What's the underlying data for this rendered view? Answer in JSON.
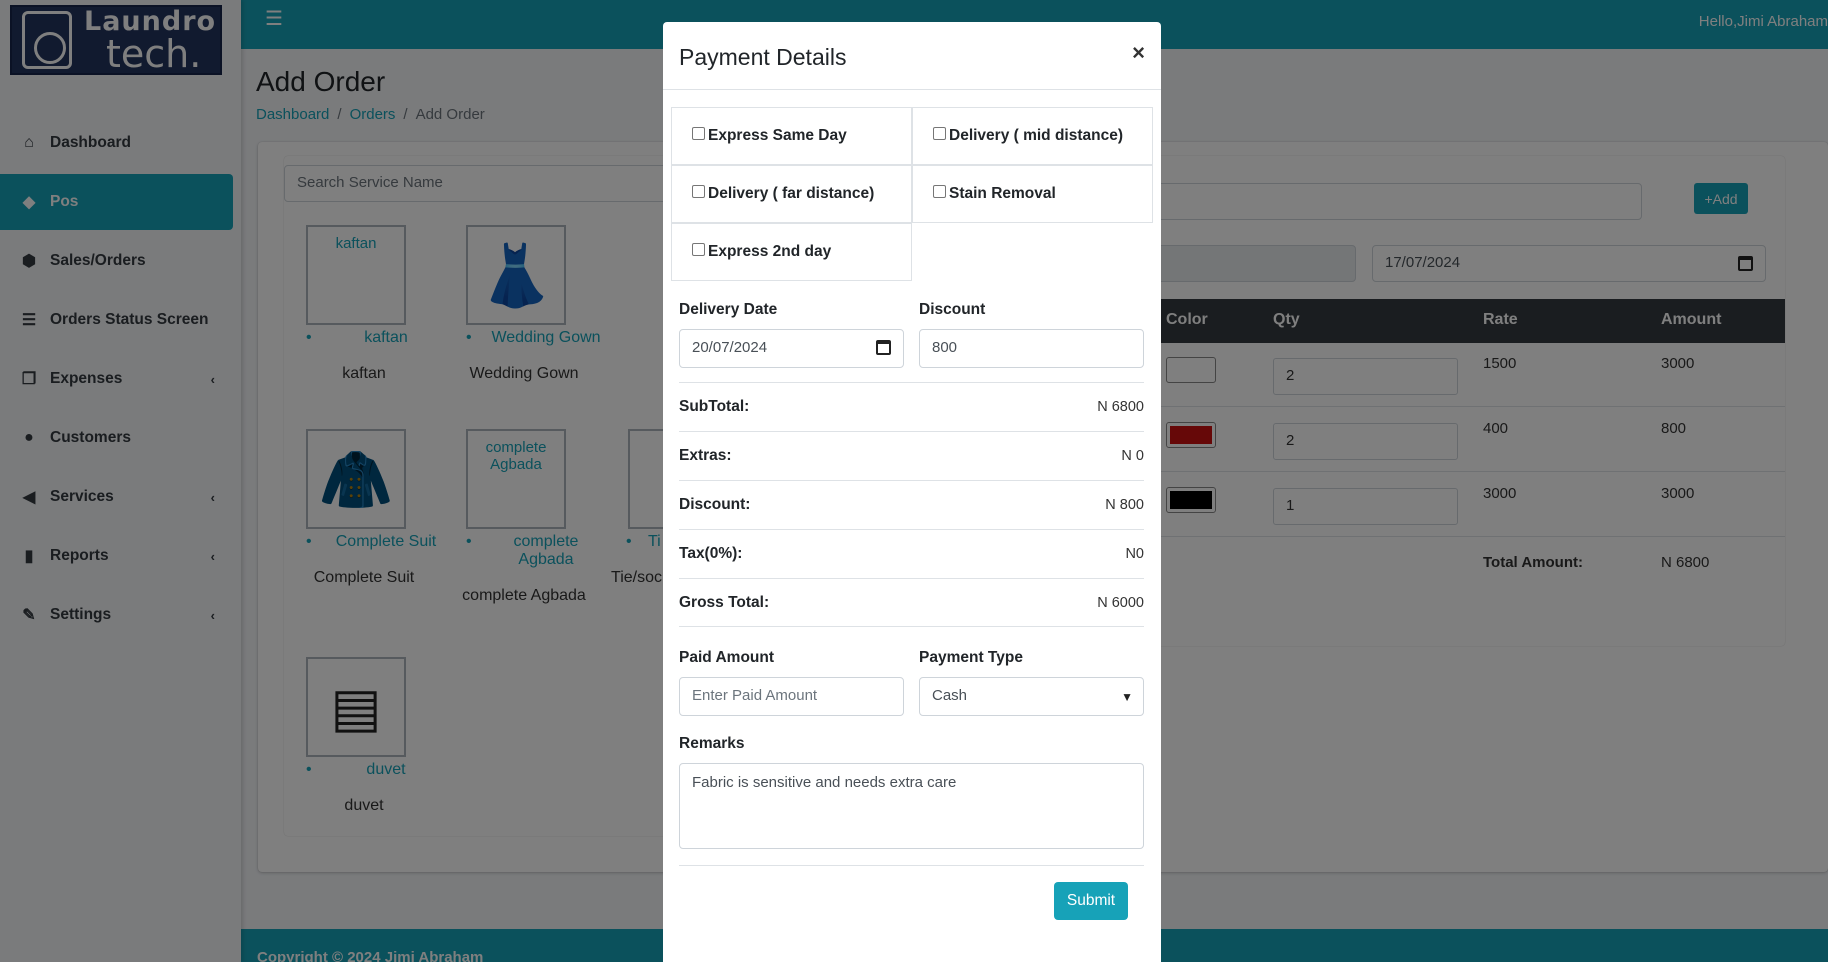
{
  "app": {
    "logo_line1": "Laundro",
    "logo_line2": "tech.",
    "greeting": "Hello,Jimi Abraham"
  },
  "sidebar": {
    "items": [
      {
        "label": "Dashboard",
        "icon": "home-icon",
        "glyph": "⌂"
      },
      {
        "label": "Pos",
        "icon": "tag-icon",
        "glyph": "◆"
      },
      {
        "label": "Sales/Orders",
        "icon": "cube-icon",
        "glyph": "⬢"
      },
      {
        "label": "Orders Status Screen",
        "icon": "list-icon",
        "glyph": "☰"
      },
      {
        "label": "Expenses",
        "icon": "copy-icon",
        "glyph": "❐"
      },
      {
        "label": "Customers",
        "icon": "user-icon",
        "glyph": "●"
      },
      {
        "label": "Services",
        "icon": "bullhorn-icon",
        "glyph": "◀"
      },
      {
        "label": "Reports",
        "icon": "chart-icon",
        "glyph": "▮"
      },
      {
        "label": "Settings",
        "icon": "wrench-icon",
        "glyph": "✎"
      }
    ],
    "chevron": "‹"
  },
  "page": {
    "title": "Add Order",
    "breadcrumb": [
      "Dashboard",
      "Orders",
      "Add Order"
    ],
    "sep": "/"
  },
  "services": {
    "search_placeholder": "Search Service Name",
    "tiles": [
      {
        "img_alt": "kaftan",
        "link": "kaftan",
        "name": "kaftan",
        "icon": "kaftan-icon"
      },
      {
        "img_alt": "",
        "link": "Wedding Gown",
        "name": "Wedding Gown",
        "icon": "dress-icon"
      },
      {
        "img_alt": "",
        "link": "Complete Suit",
        "name": "Complete Suit",
        "icon": "suit-icon"
      },
      {
        "img_alt": "complete Agbada",
        "link": "complete Agbada",
        "name": "complete Agbada",
        "icon": "agbada-icon"
      },
      {
        "img_alt": "",
        "link": "duvet",
        "name": "duvet",
        "icon": "duvet-icon"
      }
    ],
    "partial": {
      "link": "Ti",
      "name": "Tie/sock"
    }
  },
  "order": {
    "add_label": "+Add",
    "date": "17/07/2024",
    "columns": [
      "Color",
      "Qty",
      "Rate",
      "Amount"
    ],
    "rows": [
      {
        "color": "#ffffff",
        "qty": "2",
        "rate": "1500",
        "amount": "3000"
      },
      {
        "color": "#cc1111",
        "qty": "2",
        "rate": "400",
        "amount": "800"
      },
      {
        "color": "#000000",
        "qty": "1",
        "rate": "3000",
        "amount": "3000"
      }
    ],
    "total_label": "Total Amount:",
    "total_value": "N 6800"
  },
  "footer": {
    "text": "Copyright © 2024 Jimi Abraham"
  },
  "modal": {
    "title": "Payment Details",
    "close": "×",
    "options": [
      "Express Same Day",
      "Delivery ( mid distance)",
      "Delivery ( far distance)",
      "Stain Removal",
      "Express 2nd day"
    ],
    "delivery_date_label": "Delivery Date",
    "delivery_date": "20/07/2024",
    "discount_label": "Discount",
    "discount_value": "800",
    "summary": [
      {
        "k": "SubTotal:",
        "v": "N 6800"
      },
      {
        "k": "Extras:",
        "v": "N 0"
      },
      {
        "k": "Discount:",
        "v": "N 800"
      },
      {
        "k": "Tax(0%):",
        "v": "N0"
      },
      {
        "k": "Gross Total:",
        "v": "N 6000"
      }
    ],
    "paid_label": "Paid Amount",
    "paid_placeholder": "Enter Paid Amount",
    "ptype_label": "Payment Type",
    "ptype_value": "Cash",
    "remarks_label": "Remarks",
    "remarks_value": "Fabric is sensitive and needs extra care",
    "submit": "Submit"
  },
  "colors": {
    "accent": "#17a2b8",
    "sidebar_bg": "#f4f6f9",
    "table_head": "#343a40"
  }
}
